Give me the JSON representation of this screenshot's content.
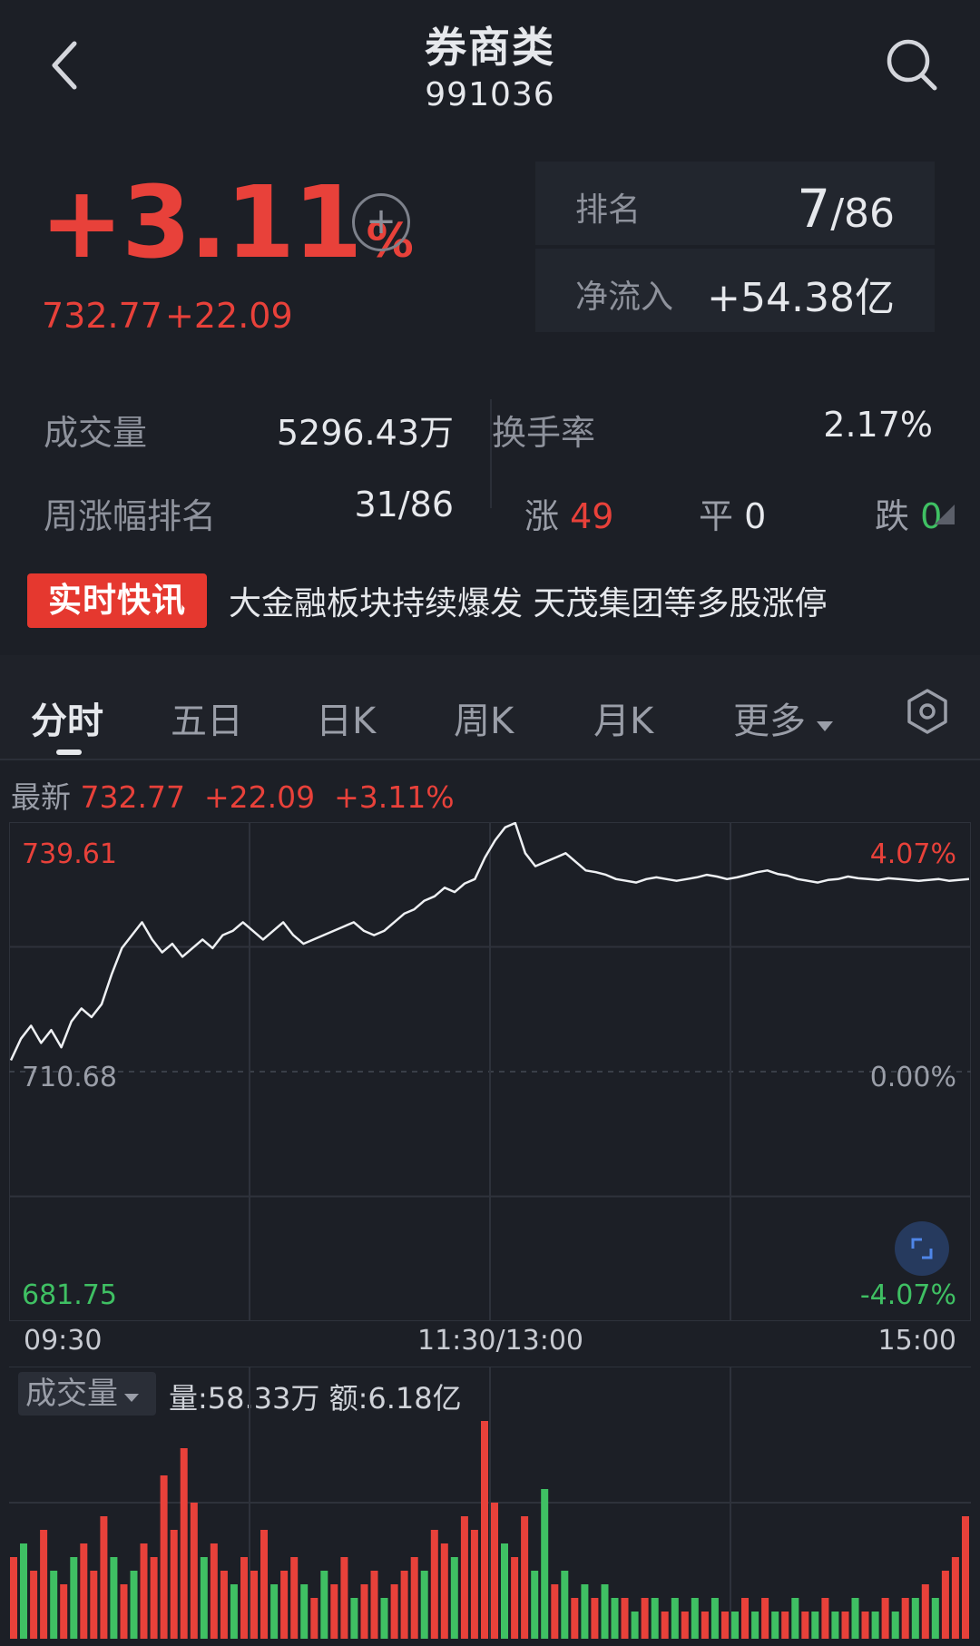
{
  "header": {
    "title": "券商类",
    "code": "991036"
  },
  "quote": {
    "change_pct": "+3.11",
    "pct_unit": "%",
    "add_symbol": "+",
    "price": "732.77",
    "change": "+22.09"
  },
  "rank_panel": {
    "rank_label": "排名",
    "rank_num": "7",
    "rank_den": "/86",
    "flow_label": "净流入",
    "flow_value": "+54.38亿"
  },
  "stats": {
    "volume_label": "成交量",
    "volume_value": "5296.43万",
    "turnover_label": "换手率",
    "turnover_value": "2.17%",
    "week_rank_label": "周涨幅排名",
    "week_rank_value": "31/86",
    "up_label": "涨",
    "up_value": "49",
    "flat_label": "平",
    "flat_value": "0",
    "down_label": "跌",
    "down_value": "0"
  },
  "news": {
    "badge": "实时快讯",
    "headline": "大金融板块持续爆发 天茂集团等多股涨停"
  },
  "tabs": [
    "分时",
    "五日",
    "日K",
    "周K",
    "月K",
    "更多"
  ],
  "chart_header": {
    "latest_label": "最新",
    "latest_price": "732.77",
    "latest_change": "+22.09",
    "latest_pct": "+3.11%"
  },
  "axis": {
    "top_price": "739.61",
    "mid_price": "710.68",
    "bottom_price": "681.75",
    "top_pct": "4.07%",
    "mid_pct": "0.00%",
    "bottom_pct": "-4.07%",
    "time_start": "09:30",
    "time_mid": "11:30/13:00",
    "time_end": "15:00"
  },
  "volume": {
    "tag": "成交量",
    "info": "量:58.33万 额:6.18亿"
  },
  "colors": {
    "up": "#e8413a",
    "down": "#3fc063",
    "background": "#1c1f26"
  },
  "chart_data": {
    "type": "line",
    "y_range": [
      681.75,
      739.61
    ],
    "reference_price": 710.68,
    "x_ticks": [
      "09:30",
      "11:30/13:00",
      "15:00"
    ],
    "price_series": [
      712.0,
      714.5,
      716.0,
      714.0,
      715.5,
      713.5,
      716.5,
      718.0,
      717.0,
      718.5,
      722.0,
      725.0,
      726.5,
      728.0,
      726.0,
      724.5,
      725.5,
      724.0,
      725.0,
      726.0,
      725.0,
      726.5,
      727.0,
      728.0,
      727.0,
      726.0,
      727.0,
      728.0,
      726.5,
      725.5,
      726.0,
      726.5,
      727.0,
      727.5,
      728.0,
      727.0,
      726.5,
      727.0,
      728.0,
      729.0,
      729.5,
      730.5,
      731.0,
      732.0,
      731.5,
      732.5,
      733.0,
      735.5,
      737.5,
      739.0,
      739.5,
      736.0,
      734.5,
      735.0,
      735.5,
      736.0,
      735.0,
      734.0,
      733.8,
      733.5,
      733.0,
      732.8,
      732.6,
      733.0,
      733.2,
      733.0,
      732.8,
      733.0,
      733.2,
      733.5,
      733.3,
      733.0,
      733.2,
      733.5,
      733.8,
      734.0,
      733.6,
      733.4,
      733.0,
      732.8,
      732.6,
      732.9,
      733.0,
      733.3,
      733.1,
      733.0,
      732.9,
      733.1,
      733.0,
      732.9,
      732.8,
      732.9,
      733.0,
      732.8,
      732.9,
      733.0
    ],
    "volume_series": [
      6,
      7,
      5,
      8,
      5,
      4,
      6,
      7,
      5,
      9,
      6,
      4,
      5,
      7,
      6,
      12,
      8,
      14,
      10,
      6,
      7,
      5,
      4,
      6,
      5,
      8,
      4,
      5,
      6,
      4,
      3,
      5,
      4,
      6,
      3,
      4,
      5,
      3,
      4,
      5,
      6,
      5,
      8,
      7,
      6,
      9,
      8,
      16,
      10,
      7,
      6,
      9,
      5,
      11,
      4,
      5,
      3,
      4,
      3,
      4,
      3,
      3,
      2,
      3,
      3,
      2,
      3,
      2,
      3,
      2,
      3,
      2,
      2,
      3,
      2,
      3,
      2,
      2,
      3,
      2,
      2,
      3,
      2,
      2,
      3,
      2,
      2,
      3,
      2,
      3,
      3,
      4,
      3,
      5,
      6,
      9
    ],
    "volume_colors": [
      "r",
      "g",
      "r",
      "r",
      "g",
      "r",
      "g",
      "r",
      "r",
      "r",
      "g",
      "r",
      "g",
      "r",
      "r",
      "r",
      "r",
      "r",
      "r",
      "g",
      "r",
      "r",
      "g",
      "r",
      "r",
      "r",
      "g",
      "r",
      "r",
      "g",
      "r",
      "g",
      "r",
      "r",
      "g",
      "r",
      "r",
      "g",
      "r",
      "r",
      "r",
      "g",
      "r",
      "r",
      "g",
      "r",
      "r",
      "r",
      "r",
      "g",
      "r",
      "r",
      "g",
      "g",
      "r",
      "g",
      "r",
      "g",
      "r",
      "g",
      "g",
      "r",
      "g",
      "r",
      "g",
      "r",
      "g",
      "r",
      "g",
      "r",
      "g",
      "r",
      "g",
      "r",
      "g",
      "r",
      "g",
      "r",
      "g",
      "r",
      "g",
      "r",
      "g",
      "r",
      "g",
      "r",
      "g",
      "r",
      "g",
      "r",
      "g",
      "r",
      "g",
      "r",
      "r",
      "r"
    ]
  }
}
